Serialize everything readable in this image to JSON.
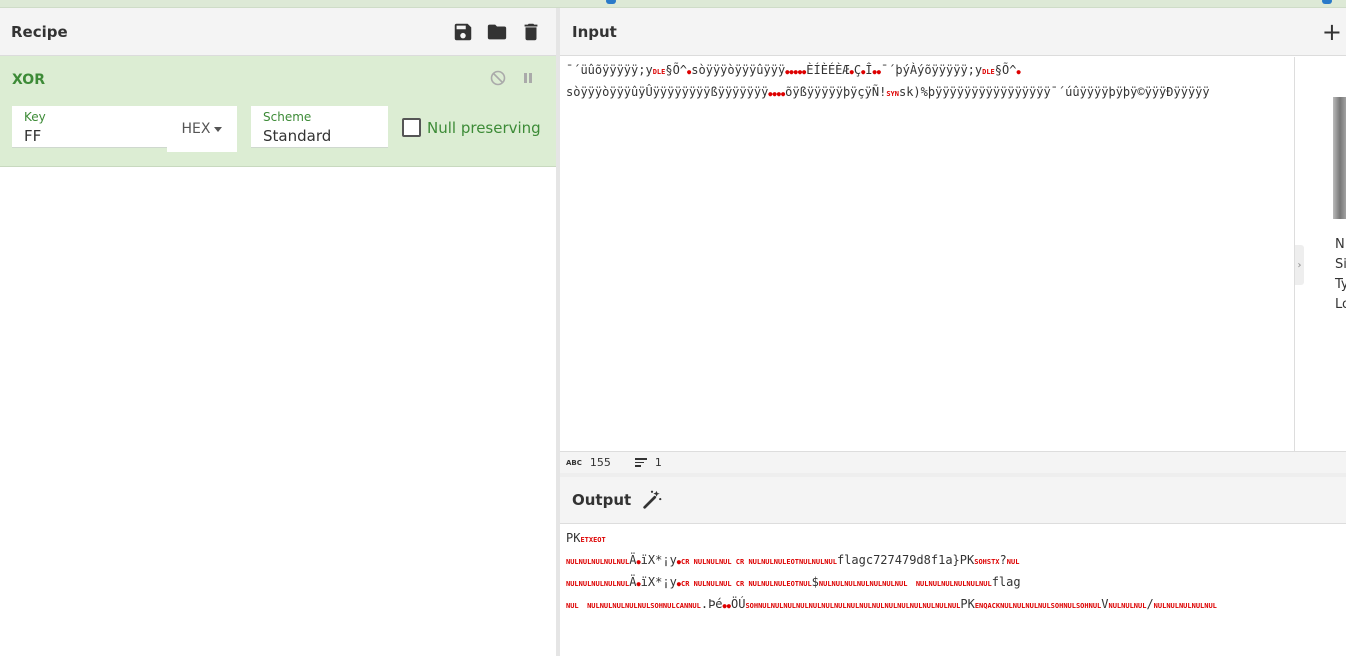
{
  "recipe": {
    "title": "Recipe",
    "operation": {
      "name": "XOR",
      "key_label": "Key",
      "key_value": "FF",
      "key_format": "HEX",
      "scheme_label": "Scheme",
      "scheme_value": "Standard",
      "null_preserving_label": "Null preserving"
    }
  },
  "input": {
    "title": "Input",
    "line1": "¯´üûõÿÿÿÿÿ;y",
    "line1b": "§Õ^",
    "line1c": "sòÿÿÿòÿÿÿûÿÿÿ",
    "line1d": "ÈÍÈÉÈÆ",
    "line1e": "Ç",
    "line1f": "Î",
    "line1g": "¯´þýÀýõÿÿÿÿÿ;y",
    "line1h": "§Õ^",
    "line2": "sòÿÿÿòÿÿÿûÿÛÿÿÿÿÿÿÿÿßÿÿÿÿÿÿÿ",
    "line2b": "õÿßÿÿÿÿÿþÿçÿÑ!",
    "line2c": "sk)%þÿÿÿÿÿÿÿÿÿÿÿÿÿÿÿÿ¯´úûÿÿÿÿþÿþÿ©ÿÿÿÐÿÿÿÿÿ",
    "ctrl_dle": "DLE",
    "ctrl_syn": "SYN",
    "side_meta": "N\nSi\nTy\nLo",
    "status_chars": "155",
    "status_lines": "1",
    "status_abc": "ABC"
  },
  "output": {
    "title": "Output",
    "l1a": "PK",
    "l1c": "ETXEOT",
    "l2c1": "NULNULNULNULNUL",
    "l2a": "Ä",
    "l2b": "ïX*¡y",
    "l2c2": "CR NULNULNUL CR NULNULNULEOTNULNULNUL",
    "l2d": "flagc727479d8f1a}PK",
    "l2c3": "SOHSTX",
    "l2e": "?",
    "l2c4": "NUL",
    "l3c1": "NULNULNULNULNUL",
    "l3a": "Ä",
    "l3b": "ïX*¡y",
    "l3c2": "CR NULNULNUL CR NULNULNULEOTNUL",
    "l3d": "$",
    "l3c3": "NULNULNULNULNULNULNUL  NULNULNULNULNULNUL",
    "l3e": "flag",
    "l4c1": "NUL  NULNULNULNULNULSOHNULCANNUL",
    "l4a": ".Þé",
    "l4b": "ÖÚ",
    "l4c2": "SOHNULNULNULNULNULNULNULNULNULNULNULNULNULNULNULNUL",
    "l4d": "PK",
    "l4c3": "ENQACKNULNULNULNULSOHNULSOHNUL",
    "l4e": "V",
    "l4c4": "NULNULNUL",
    "l4f": "/",
    "l4c5": "NULNULNULNULNUL"
  },
  "colors": {
    "accent_green": "#3d8b37",
    "op_background": "#dcedd3",
    "control_char_red": "#dd0000"
  }
}
